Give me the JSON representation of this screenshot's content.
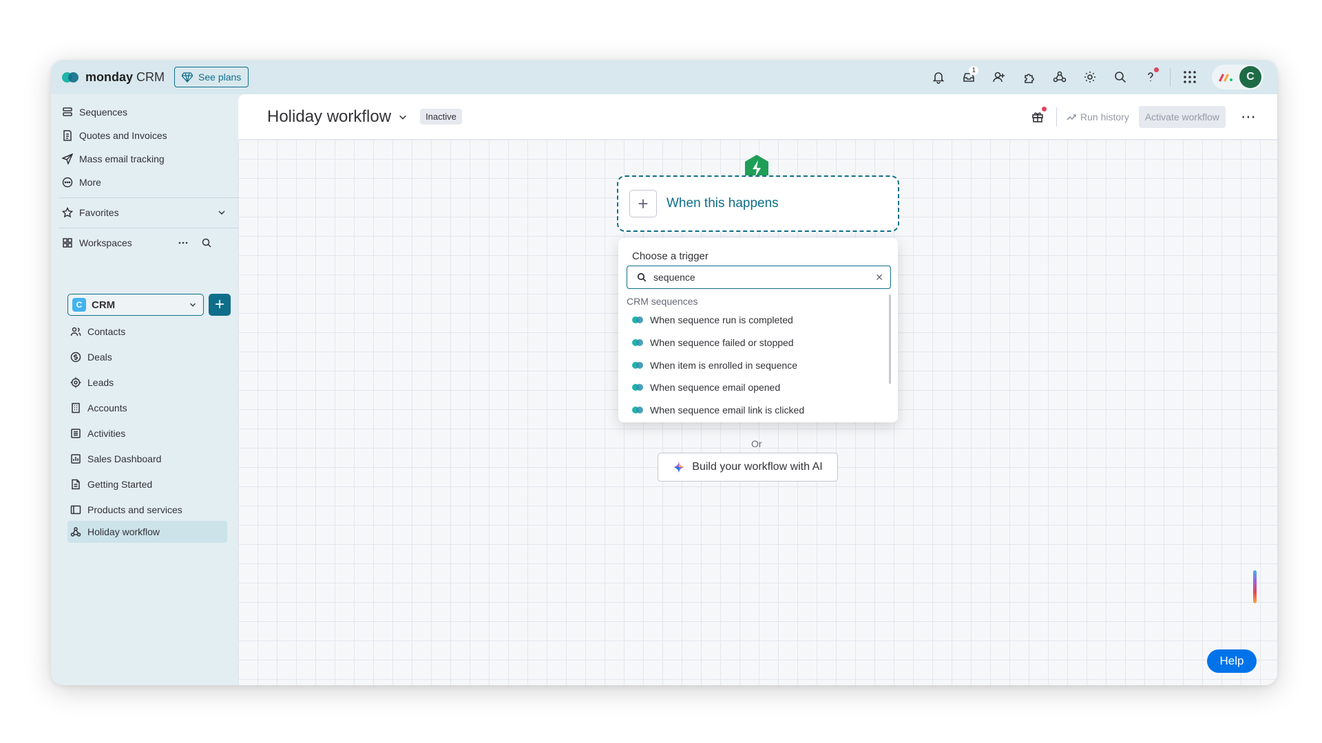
{
  "app": {
    "brand": "monday",
    "brand_suffix": "CRM",
    "see_plans": "See plans"
  },
  "topbar": {
    "inbox_count": "1",
    "avatar_letter": "C"
  },
  "sidebar": {
    "items_top": [
      {
        "label": "Sequences"
      },
      {
        "label": "Quotes and Invoices"
      },
      {
        "label": "Mass email tracking"
      },
      {
        "label": "More"
      }
    ],
    "favorites": "Favorites",
    "workspaces": "Workspaces",
    "workspace": {
      "badge": "C",
      "name": "CRM"
    },
    "boards": [
      {
        "label": "Contacts"
      },
      {
        "label": "Deals"
      },
      {
        "label": "Leads"
      },
      {
        "label": "Accounts"
      },
      {
        "label": "Activities"
      },
      {
        "label": "Sales Dashboard"
      },
      {
        "label": "Getting Started"
      },
      {
        "label": "Products and services"
      },
      {
        "label": "Holiday workflow"
      }
    ]
  },
  "header": {
    "title": "Holiday workflow",
    "status": "Inactive",
    "run_history": "Run history",
    "activate": "Activate workflow"
  },
  "canvas": {
    "trigger_label": "When this happens",
    "dropdown": {
      "title": "Choose a trigger",
      "search_value": "sequence",
      "group": "CRM sequences",
      "items": [
        {
          "label": "When sequence run is completed"
        },
        {
          "label": "When sequence failed or stopped"
        },
        {
          "label": "When item is enrolled in sequence"
        },
        {
          "label": "When sequence email opened"
        },
        {
          "label": "When sequence email link is clicked"
        }
      ]
    },
    "or": "Or",
    "ai_button": "Build your workflow with AI",
    "help": "Help"
  },
  "colors": {
    "accent": "#0f6e8a",
    "trigger_green": "#1e9e56",
    "help_blue": "#0073ea"
  }
}
